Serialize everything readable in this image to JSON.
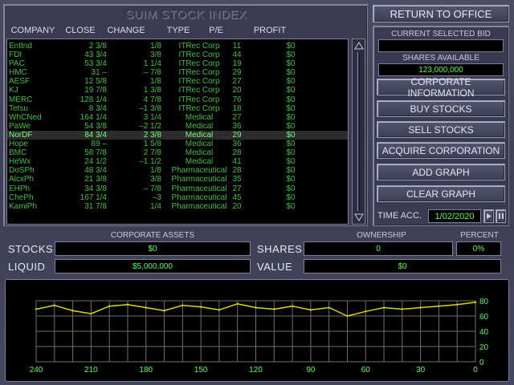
{
  "index_title": "SUIM STOCK INDEX",
  "columns": [
    "COMPANY",
    "CLOSE",
    "CHANGE",
    "TYPE",
    "P/E",
    "PROFIT"
  ],
  "stocks": [
    {
      "company": "EntInd",
      "close": "2 3/8",
      "change": "1/8",
      "type": "ITRec Corp",
      "pe": "11",
      "profit": "$0"
    },
    {
      "company": "FDI",
      "close": "43 3/4",
      "change": "3/8",
      "type": "ITRec Corp",
      "pe": "44",
      "profit": "$0"
    },
    {
      "company": "PAC",
      "close": "53 3/4",
      "change": "1 1/4",
      "type": "ITRec Corp",
      "pe": "19",
      "profit": "$0"
    },
    {
      "company": "HMC",
      "close": "31 –",
      "change": "– 7/8",
      "type": "ITRec Corp",
      "pe": "29",
      "profit": "$0"
    },
    {
      "company": "AESF",
      "close": "12 5/8",
      "change": "1/8",
      "type": "ITRec Corp",
      "pe": "27",
      "profit": "$0"
    },
    {
      "company": "KJ",
      "close": "19 7/8",
      "change": "1 3/8",
      "type": "ITRec Corp",
      "pe": "20",
      "profit": "$0"
    },
    {
      "company": "MERC",
      "close": "128 1/4",
      "change": "4 7/8",
      "type": "ITRec Corp",
      "pe": "76",
      "profit": "$0"
    },
    {
      "company": "Tetsu",
      "close": "8 3/4",
      "change": "–1 3/8",
      "type": "ITRec Corp",
      "pe": "18",
      "profit": "$0"
    },
    {
      "company": "WhCNed",
      "close": "164 1/4",
      "change": "3 1/4",
      "type": "Medical",
      "pe": "27",
      "profit": "$0"
    },
    {
      "company": "PaWe",
      "close": "54 3/8",
      "change": "–2 1/2",
      "type": "Medical",
      "pe": "36",
      "profit": "$0"
    },
    {
      "company": "NorDF",
      "close": "84 3/4",
      "change": "2 3/8",
      "type": "Medical",
      "pe": "29",
      "profit": "$0",
      "selected": true
    },
    {
      "company": "Hope",
      "close": "89 –",
      "change": "1 5/8",
      "type": "Medical",
      "pe": "36",
      "profit": "$0"
    },
    {
      "company": "BMC",
      "close": "58 7/8",
      "change": "2 7/8",
      "type": "Medical",
      "pe": "28",
      "profit": "$0"
    },
    {
      "company": "HeWx",
      "close": "24 1/2",
      "change": "–1 1/2",
      "type": "Medical",
      "pe": "41",
      "profit": "$0"
    },
    {
      "company": "DoSPh",
      "close": "48 3/4",
      "change": "1/8",
      "type": "Pharmaceutical",
      "pe": "28",
      "profit": "$0"
    },
    {
      "company": "AlcxPh",
      "close": "21 3/8",
      "change": "3/8",
      "type": "Pharmaceutical",
      "pe": "35",
      "profit": "$0"
    },
    {
      "company": "EHPh",
      "close": "34 3/8",
      "change": "– 7/8",
      "type": "Pharmaceutical",
      "pe": "27",
      "profit": "$0"
    },
    {
      "company": "ChePh",
      "close": "167 1/4",
      "change": "–3",
      "type": "Pharmaceutical",
      "pe": "45",
      "profit": "$0"
    },
    {
      "company": "KamiPh",
      "close": "31 7/8",
      "change": "1/4",
      "type": "Pharmaceutical",
      "pe": "20",
      "profit": "$0"
    }
  ],
  "right": {
    "return_label": "RETURN TO OFFICE",
    "current_bid_label": "CURRENT SELECTED BID",
    "current_bid_value": "",
    "shares_available_label": "SHARES AVAILABLE",
    "shares_available_value": "123,000,000",
    "buttons": [
      "CORPORATE INFORMATION",
      "BUY STOCKS",
      "SELL STOCKS",
      "ACQUIRE CORPORATION",
      "ADD GRAPH",
      "CLEAR GRAPH"
    ],
    "time_acc_label": "TIME ACC.",
    "date": "1/02/2020"
  },
  "assets": {
    "corporate_assets_label": "CORPORATE ASSETS",
    "ownership_label": "OWNERSHIP",
    "percent_label": "PERCENT",
    "stocks_label": "STOCKS",
    "stocks_value": "$0",
    "liquid_label": "LIQUID",
    "liquid_value": "$5,000,000",
    "shares_label": "SHARES",
    "shares_value": "0",
    "percent_value": "0%",
    "value_label": "VALUE",
    "value_value": "$0"
  },
  "chart_data": {
    "type": "line",
    "x_ticks": [
      "240",
      "210",
      "180",
      "150",
      "120",
      "90",
      "60",
      "30",
      "0"
    ],
    "y_ticks": [
      "80",
      "60",
      "40",
      "20",
      "0"
    ],
    "ylim": [
      0,
      80
    ],
    "grid": true,
    "line_color": "#d9d900",
    "x": [
      240,
      230,
      220,
      210,
      200,
      190,
      180,
      170,
      160,
      150,
      140,
      130,
      120,
      110,
      100,
      90,
      80,
      70,
      60,
      50,
      40,
      30,
      20,
      10,
      0
    ],
    "y": [
      69,
      74,
      67,
      63,
      73,
      75,
      71,
      67,
      74,
      72,
      68,
      76,
      71,
      69,
      73,
      68,
      71,
      60,
      66,
      71,
      69,
      71,
      73,
      75,
      78
    ]
  }
}
